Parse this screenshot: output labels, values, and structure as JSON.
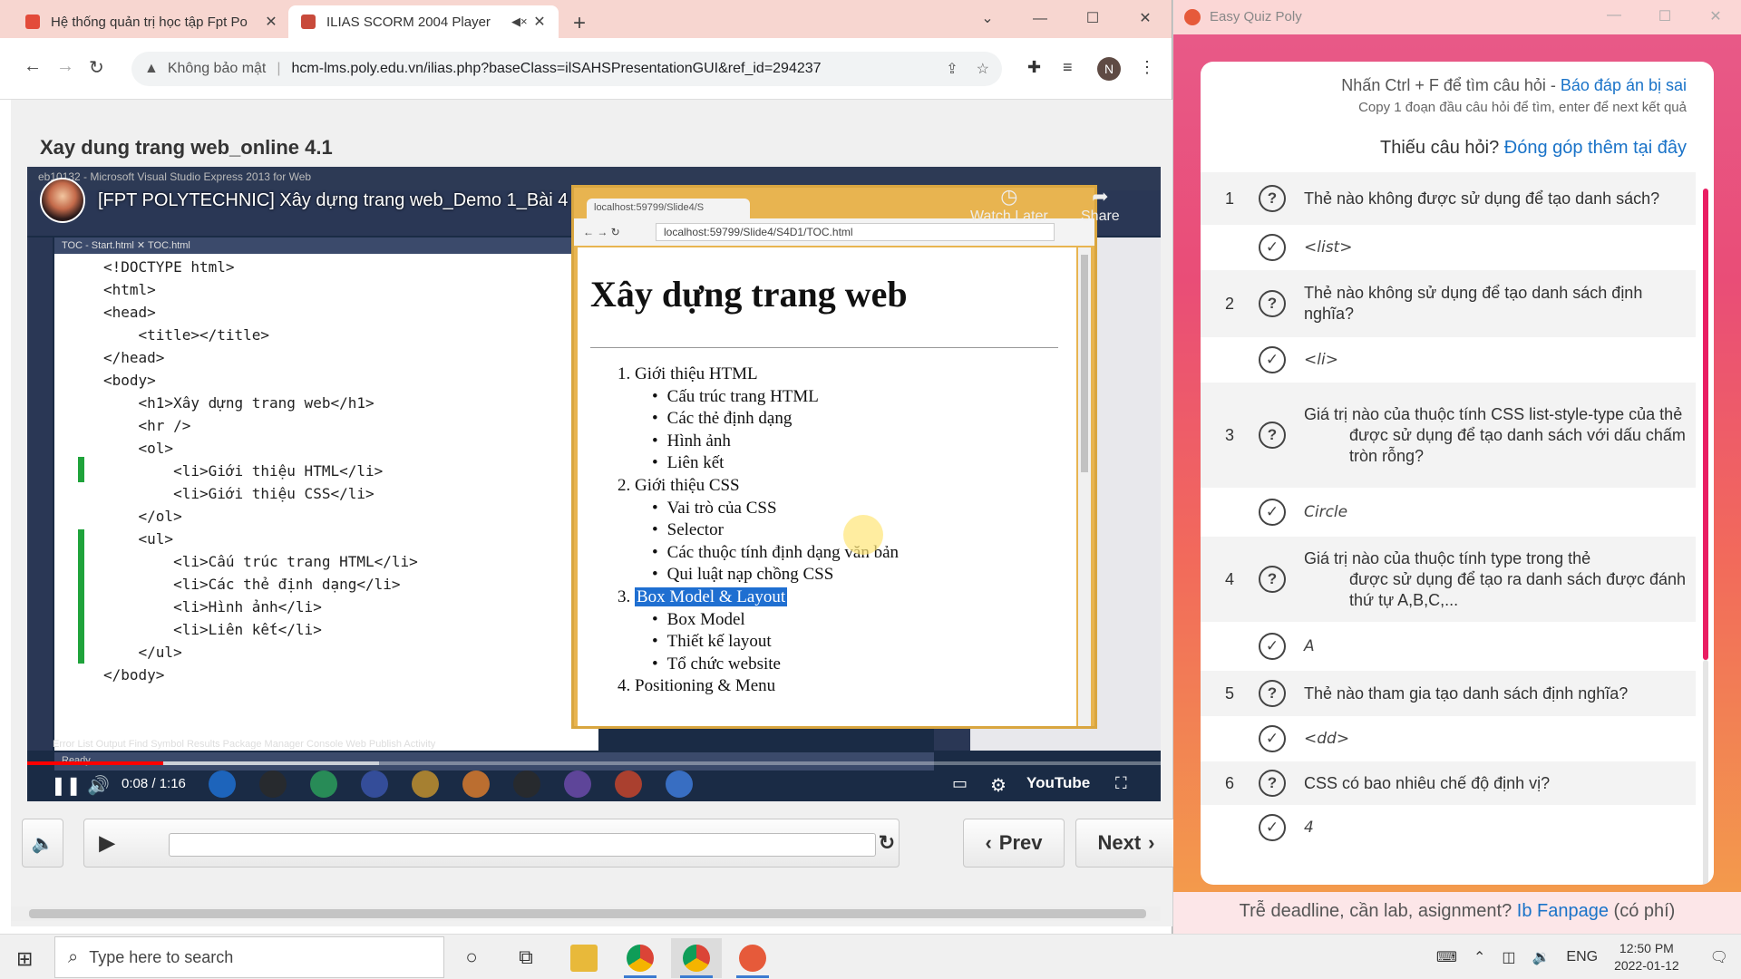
{
  "browser": {
    "tabs": [
      {
        "label": "Hệ thống quản trị học tập Fpt Po",
        "favicon_color": "#e34b3a"
      },
      {
        "label": "ILIAS SCORM 2004 Player",
        "favicon_color": "#c84a3b"
      }
    ],
    "address": {
      "security_label": "Không bảo mật",
      "url": "hcm-lms.poly.edu.vn/ilias.php?baseClass=ilSAHSPresentationGUI&ref_id=294237"
    },
    "profile_initial": "N"
  },
  "page": {
    "title": "Xay dung trang web_online 4.1"
  },
  "video": {
    "yt_title": "[FPT POLYTECHNIC] Xây dựng trang web_Demo 1_Bài 4",
    "watch_later": "Watch Later",
    "share": "Share",
    "vs_title": "eb10132 - Microsoft Visual Studio Express 2013 for Web",
    "vs_tabs": "TOC - Start.html  ✕  TOC.html",
    "vs_panels": "Error List   Output   Find Symbol Results   Package Manager Console   Web Publish Activity",
    "vs_status": "Ready",
    "code_lines": [
      "<!DOCTYPE html>",
      "<html>",
      "<head>",
      "    <title></title>",
      "</head>",
      "<body>",
      "    <h1>Xây dựng trang web</h1>",
      "    <hr />",
      "    <ol>",
      "        <li>Giới thiệu HTML</li>",
      "        <li>Giới thiệu CSS</li>",
      "    </ol>",
      "    <ul>",
      "        <li>Cấu trúc trang HTML</li>",
      "        <li>Các thẻ định dạng</li>",
      "        <li>Hình ảnh</li>",
      "        <li>Liên kết</li>",
      "    </ul>",
      "</body>"
    ],
    "embedded_browser": {
      "tab": "localhost:59799/Slide4/S",
      "url": "localhost:59799/Slide4/S4D1/TOC.html",
      "heading": "Xây dựng trang web",
      "outline": [
        {
          "num": "1.",
          "text": "Giới thiệu HTML",
          "items": [
            "Cấu trúc trang HTML",
            "Các thẻ định dạng",
            "Hình ảnh",
            "Liên kết"
          ]
        },
        {
          "num": "2.",
          "text": "Giới thiệu CSS",
          "items": [
            "Vai trò của CSS",
            "Selector",
            "Các thuộc tính định dạng văn bản",
            "Qui luật nạp chồng CSS"
          ]
        },
        {
          "num": "3.",
          "text": "Box Model & Layout",
          "items": [
            "Box Model",
            "Thiết kế layout",
            "Tổ chức website"
          ]
        },
        {
          "num": "4.",
          "text": "Positioning & Menu",
          "items": []
        }
      ]
    },
    "time": "0:08 / 1:16",
    "progress_fraction": 0.12,
    "youtube_label": "YouTube"
  },
  "player": {
    "prev_label": "Prev",
    "next_label": "Next"
  },
  "quiz": {
    "window_title": "Easy Quiz Poly",
    "hint_prefix": "Nhấn Ctrl + F để tìm câu hỏi - ",
    "hint_link": "Báo đáp án bị sai",
    "hint_sub": "Copy 1 đoạn đầu câu hỏi để tìm, enter để next kết quả",
    "contrib_prefix": "Thiếu câu hỏi? ",
    "contrib_link": "Đóng góp thêm tại đây",
    "items": [
      {
        "num": "1",
        "question": "Thẻ nào không được sử dụng để tạo danh sách?",
        "answer": "<list>"
      },
      {
        "num": "2",
        "question": "Thẻ nào không sử dụng để tạo danh sách định nghĩa?",
        "answer": "<li>"
      },
      {
        "num": "3",
        "question": "Giá trị nào của thuộc tính CSS list-style-type của thẻ",
        "question_2": "được sử dụng để tạo danh sách với dấu chấm tròn rỗng?",
        "answer": "Circle"
      },
      {
        "num": "4",
        "question": "Giá trị nào của thuộc tính type trong thẻ",
        "question_2": "được sử dụng để tạo ra danh sách được đánh thứ tự A,B,C,...",
        "answer": "A"
      },
      {
        "num": "5",
        "question": "Thẻ nào tham gia tạo danh sách định nghĩa?",
        "answer": "<dd>"
      },
      {
        "num": "6",
        "question": "CSS có bao nhiêu chế độ định vị?",
        "answer": "4"
      }
    ],
    "footer_prefix": "Trễ deadline, cần lab, asignment? ",
    "footer_link": "Ib Fanpage",
    "footer_suffix": " (có phí)"
  },
  "taskbar": {
    "search_placeholder": "Type here to search",
    "language": "ENG",
    "time": "12:50 PM",
    "date": "2022-01-12"
  },
  "colors": {
    "tab_bar": "#f7d6d0",
    "quiz_link": "#1a73c8",
    "highlight": "#1f6fd1"
  }
}
